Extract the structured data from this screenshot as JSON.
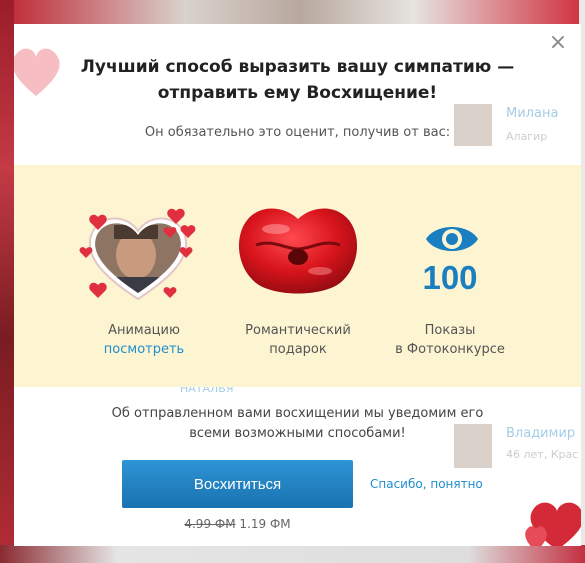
{
  "background": {
    "cards": [
      {
        "name": "Милана",
        "sub": "Алагир"
      },
      {
        "name": "НАТАЛЬЯ",
        "sub": ""
      },
      {
        "name": "Владимир",
        "sub": "46 лет, Крас"
      }
    ]
  },
  "modal": {
    "close_icon": "×",
    "title_line1": "Лучший способ выразить вашу симпатию —",
    "title_line2": "отправить ему Восхищение!",
    "subtitle": "Он обязательно это оценит, получив от вас:",
    "perks": [
      {
        "icon": "heart-photo-icon",
        "label": "Анимацию",
        "link": "посмотреть"
      },
      {
        "icon": "kiss-lips-icon",
        "label_line1": "Романтический",
        "label_line2": "подарок"
      },
      {
        "icon": "eye-icon",
        "number": "100",
        "label_line1": "Показы",
        "label_line2": "в Фотоконкурсе"
      }
    ],
    "notice_line1": "Об отправленном вами восхищении мы уведомим его",
    "notice_line2": "всеми возможными способами!",
    "admire_button": "Восхититься",
    "thanks_link": "Спасибо, понятно",
    "old_price": "4.99 ФМ",
    "new_price": "1.19 ФМ"
  },
  "colors": {
    "accent": "#1f8fcf",
    "button": "#1a72b0",
    "perks_bg": "#fdf4d2",
    "lips": "#d8141c",
    "hearts": "#e0303f"
  }
}
